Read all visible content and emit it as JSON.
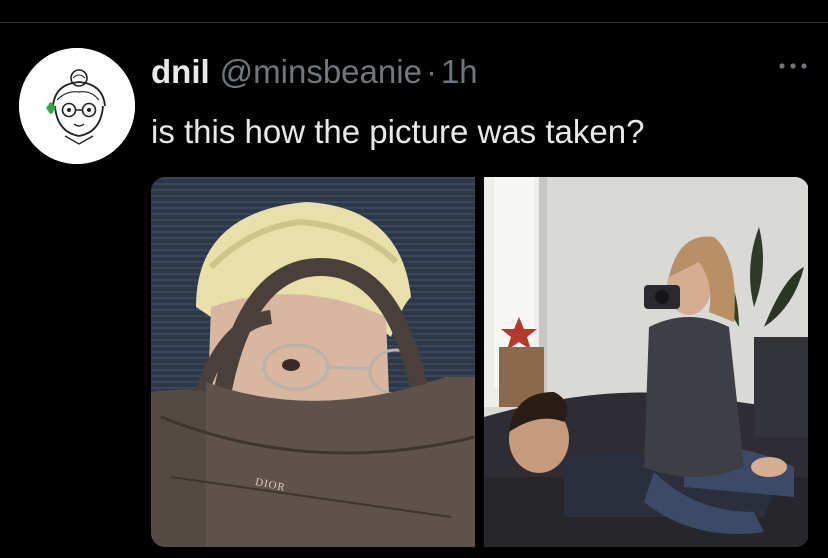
{
  "tweet": {
    "display_name": "dnil",
    "handle": "@minsbeanie",
    "separator": "·",
    "time": "1h",
    "text": "is this how the picture was taken?",
    "more_icon": "more-horizontal-icon"
  },
  "media": {
    "items": [
      {
        "bag_brand_text": "DIOR"
      },
      {}
    ]
  },
  "colors": {
    "background": "#000000",
    "primary_text": "#e7e9ea",
    "secondary_text": "#71767b",
    "divider": "#2f3336"
  }
}
